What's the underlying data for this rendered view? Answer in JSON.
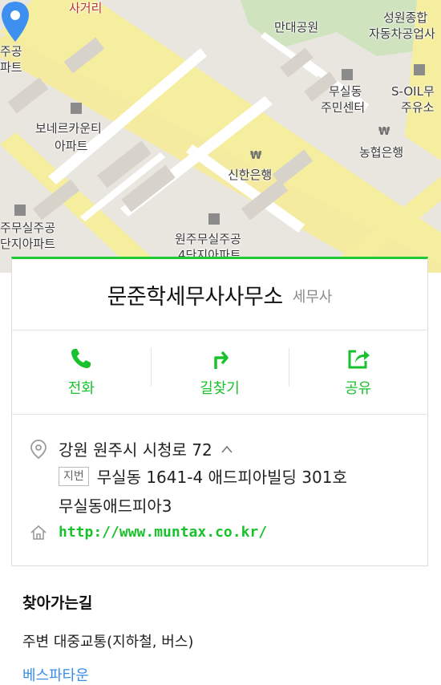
{
  "map": {
    "labels": {
      "sageori": "사거리",
      "mandae_park": "만대공원",
      "seongwon": "성원종합",
      "auto_complex": "자동차공업사",
      "apt_left1": "주공",
      "apt_left2": "파트",
      "musil_center1": "무실동",
      "musil_center2": "주민센터",
      "soil1": "S-OIL무",
      "soil2": "주유소",
      "bonair1": "보네르카운티",
      "bonair2": "아파트",
      "shinhan": "신한은행",
      "nonghyup": "농협은행",
      "musil_jugong1": "주무실주공",
      "musil_jugong2": "단지아파트",
      "wonju_musil1": "원주무실주공",
      "wonju_musil2": "4단지아파트"
    }
  },
  "place": {
    "name": "문준학세무사사무소",
    "category": "세무사"
  },
  "actions": {
    "call": "전화",
    "route": "길찾기",
    "share": "공유"
  },
  "info": {
    "address": "강원 원주시 시청로 72",
    "jibun_badge": "지번",
    "jibun": "무실동 1641-4 애드피아빌딩 301호",
    "building": "무실동애드피아3",
    "website": "http://www.muntax.co.kr/"
  },
  "directions": {
    "title": "찾아가는길",
    "transit": "주변 대중교통(지하철, 버스)",
    "bus_stop": "베스파타운"
  },
  "colors": {
    "accent": "#19c22c",
    "pin": "#3d8ff0",
    "link": "#3a8ee6"
  }
}
